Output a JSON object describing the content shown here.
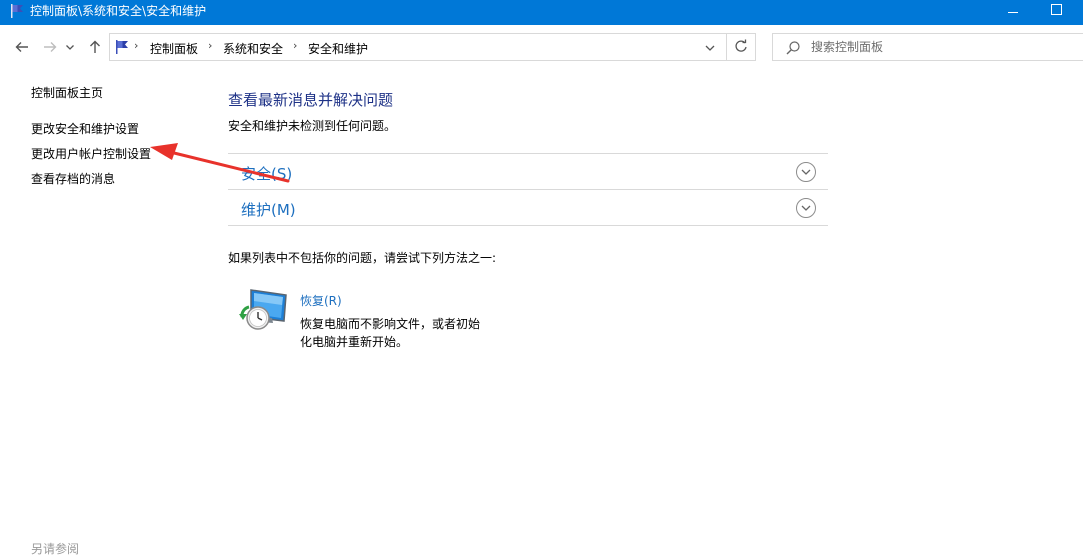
{
  "window": {
    "title": "控制面板\\系统和安全\\安全和维护",
    "accent_color": "#0078d7",
    "icon": "control-panel-flag-icon"
  },
  "nav": {
    "back_icon": "arrow-left-icon",
    "forward_icon": "arrow-right-icon",
    "recent_icon": "chevron-down-icon",
    "up_icon": "arrow-up-icon"
  },
  "address": {
    "breadcrumbs": [
      "控制面板",
      "系统和安全",
      "安全和维护"
    ],
    "separator": "›"
  },
  "search": {
    "placeholder": "搜索控制面板"
  },
  "sidebar": {
    "items": [
      {
        "label": "控制面板主页"
      },
      {
        "label": "更改安全和维护设置"
      },
      {
        "label": "更改用户帐户控制设置"
      },
      {
        "label": "查看存档的消息"
      }
    ],
    "bottom_label": "另请参阅"
  },
  "annotation": {
    "color": "#e8322b"
  },
  "main": {
    "heading": "查看最新消息并解决问题",
    "subheading": "安全和维护未检测到任何问题。",
    "sections": [
      {
        "label": "安全(S)"
      },
      {
        "label": "维护(M)"
      }
    ],
    "hint": "如果列表中不包括你的问题，请尝试下列方法之一:",
    "recovery": {
      "title": "恢复(R)",
      "description": "恢复电脑而不影响文件，或者初始化电脑并重新开始。"
    }
  }
}
